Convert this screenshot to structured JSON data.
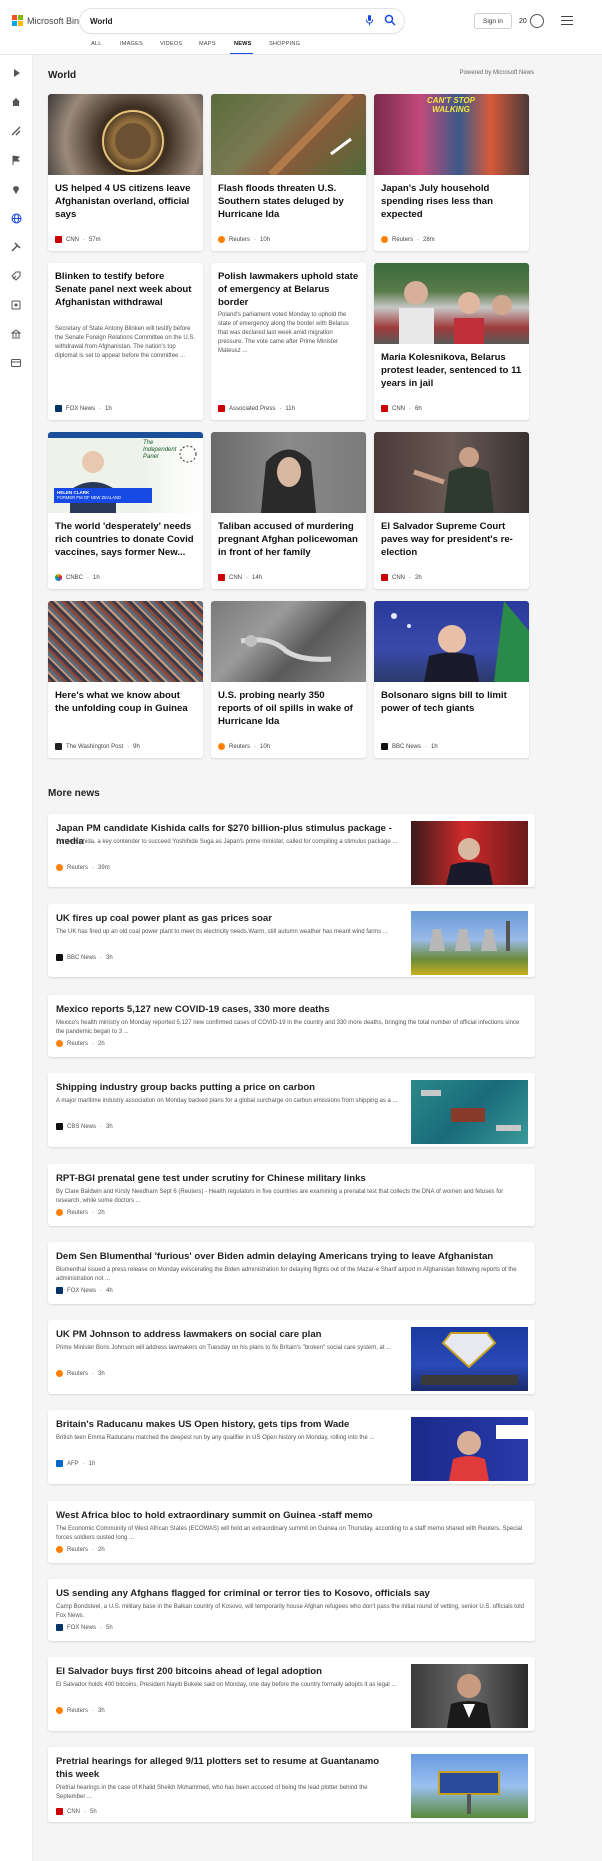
{
  "header": {
    "brand": "Microsoft Bing",
    "search_value": "World",
    "sign_in": "Sign in",
    "reward_points": "20"
  },
  "tabs": [
    "ALL",
    "IMAGES",
    "VIDEOS",
    "MAPS",
    "NEWS",
    "SHOPPING"
  ],
  "active_tab": "NEWS",
  "section": {
    "title": "World",
    "powered_by": "Powered by Microsoft News",
    "more_news_title": "More news"
  },
  "cards": [
    {
      "title": "US helped 4 US citizens leave Afghanistan overland, official says",
      "source": "CNN",
      "time": "57m",
      "source_color": "#cc0000"
    },
    {
      "title": "Flash floods threaten U.S. Southern states deluged by Hurricane Ida",
      "source": "Reuters",
      "time": "10h",
      "source_color": "#ff8000"
    },
    {
      "title": "Japan's July household spending rises less than expected",
      "source": "Reuters",
      "time": "28m",
      "source_color": "#ff8000"
    },
    {
      "title": "Blinken to testify before Senate panel next week about Afghanistan withdrawal",
      "summary": "Secretary of State Antony Blinken will testify before the Senate Foreign Relations Committee on the U.S. withdrawal from Afghanistan. The nation's top diplomat is set to appear before the committee ...",
      "source": "FOX News",
      "time": "1h",
      "source_color": "#003366"
    },
    {
      "title": "Polish lawmakers uphold state of emergency at Belarus border",
      "summary": "Poland's parliament voted Monday to uphold the state of emergency along the border with Belarus that was declared last week amid migration pressure. The vote came after Prime Minister Mateusz ...",
      "source": "Associated Press",
      "time": "11h",
      "source_color": "#cc0000"
    },
    {
      "title": "Maria Kolesnikova, Belarus protest leader, sentenced to 11 years in jail",
      "source": "CNN",
      "time": "6h",
      "source_color": "#cc0000"
    },
    {
      "title": "The world 'desperately' needs rich countries to donate Covid vaccines, says former New...",
      "source": "CNBC",
      "time": "1h",
      "source_color": "#0089d0"
    },
    {
      "title": "Taliban accused of murdering pregnant Afghan policewoman in front of her family",
      "source": "CNN",
      "time": "14h",
      "source_color": "#cc0000"
    },
    {
      "title": "El Salvador Supreme Court paves way for president's re-election",
      "source": "CNN",
      "time": "2h",
      "source_color": "#cc0000"
    },
    {
      "title": "Here's what we know about the unfolding coup in Guinea",
      "source": "The Washington Post",
      "time": "9h",
      "source_color": "#222222"
    },
    {
      "title": "U.S. probing nearly 350 reports of oil spills in wake of Hurricane Ida",
      "source": "Reuters",
      "time": "10h",
      "source_color": "#ff8000"
    },
    {
      "title": "Bolsonaro signs bill to limit power of tech giants",
      "source": "BBC News",
      "time": "1h",
      "source_color": "#111111"
    }
  ],
  "card_image_text": {
    "poster_line": "CAN'T STOP WALKING",
    "video_title": "The Independent Panel",
    "video_caption_name": "HELEN CLARK",
    "video_caption_role": "FORMER PM OF NEW ZEALAND"
  },
  "more_news": [
    {
      "title": "Japan PM candidate Kishida calls for $270 billion-plus stimulus package -media",
      "summary": "Fumio Kishida, a key contender to succeed Yoshihide Suga as Japan's prime minister, called for compiling a stimulus package ...",
      "source": "Reuters",
      "time": "39m",
      "source_color": "#ff8000"
    },
    {
      "title": "UK fires up coal power plant as gas prices soar",
      "summary": "The UK has fired up an old coal power plant to meet its electricity needs.Warm, still autumn weather has meant wind farms ...",
      "source": "BBC News",
      "time": "3h",
      "source_color": "#111111"
    },
    {
      "title": "Mexico reports 5,127 new COVID-19 cases, 330 more deaths",
      "summary": "Mexico's health ministry on Monday reported 5,127 new confirmed cases of COVID-19 in the country and 330 more deaths, bringing the total number of official infections since the pandemic began to 3 ...",
      "source": "Reuters",
      "time": "2h",
      "source_color": "#ff8000"
    },
    {
      "title": "Shipping industry group backs putting a price on carbon",
      "summary": "A major maritime industry association on Monday backed plans for a global surcharge on carbon emissions from shipping as a ...",
      "source": "CBS News",
      "time": "3h",
      "source_color": "#111111"
    },
    {
      "title": "RPT-BGI prenatal gene test under scrutiny for Chinese military links",
      "summary": "By Clare Baldwin and Kirsty Needham Sept 6 (Reuters) - Health regulators in five countries are examining a prenatal test that collects the DNA of women and fetuses for research, while some doctors ...",
      "source": "Reuters",
      "time": "2h",
      "source_color": "#ff8000"
    },
    {
      "title": "Dem Sen Blumenthal 'furious' over Biden admin delaying Americans trying to leave Afghanistan",
      "summary": "Blumenthal issued a press release on Monday eviscerating the Biden administration for delaying flights out of the Mazar-e Sharif airport in Afghanistan following reports of the administration not ...",
      "source": "FOX News",
      "time": "4h",
      "source_color": "#003366"
    },
    {
      "title": "UK PM Johnson to address lawmakers on social care plan",
      "summary": "Prime Minister Boris Johnson will address lawmakers on Tuesday on his plans to fix Britain's \"broken\" social care system, at ...",
      "source": "Reuters",
      "time": "3h",
      "source_color": "#ff8000"
    },
    {
      "title": "Britain's Raducanu makes US Open history, gets tips from Wade",
      "summary": "British teen Emma Raducanu matched the deepest run by any qualifier in US Open history on Monday, rolling into the ...",
      "source": "AFP",
      "time": "1h",
      "source_color": "#0066cc"
    },
    {
      "title": "West Africa bloc to hold extraordinary summit on Guinea -staff memo",
      "summary": "The Economic Community of West African States (ECOWAS) will hold an extraordinary summit on Guinea on Thursday, according to a staff memo shared with Reuters. Special forces soldiers ousted long ...",
      "source": "Reuters",
      "time": "2h",
      "source_color": "#ff8000"
    },
    {
      "title": "US sending any Afghans flagged for criminal or terror ties to Kosovo, officials say",
      "summary": "Camp Bondsteel, a U.S. military base in the Balkan country of Kosovo, will temporarily house Afghan refugees who don't pass the initial round of vetting, senior U.S. officials told Fox News.",
      "source": "FOX News",
      "time": "5h",
      "source_color": "#003366"
    },
    {
      "title": "El Salvador buys first 200 bitcoins ahead of legal adoption",
      "summary": "El Salvador holds 400 bitcoins, President Nayib Bukele said on Monday, one day before the country formally adopts it as legal ...",
      "source": "Reuters",
      "time": "3h",
      "source_color": "#ff8000"
    },
    {
      "title": "Pretrial hearings for alleged 9/11 plotters set to resume at Guantanamo this week",
      "summary": "Pretrial hearings in the case of Khalid Sheikh Mohammed, who has been accused of being the lead plotter behind the September ...",
      "source": "CNN",
      "time": "5h",
      "source_color": "#cc0000"
    }
  ]
}
